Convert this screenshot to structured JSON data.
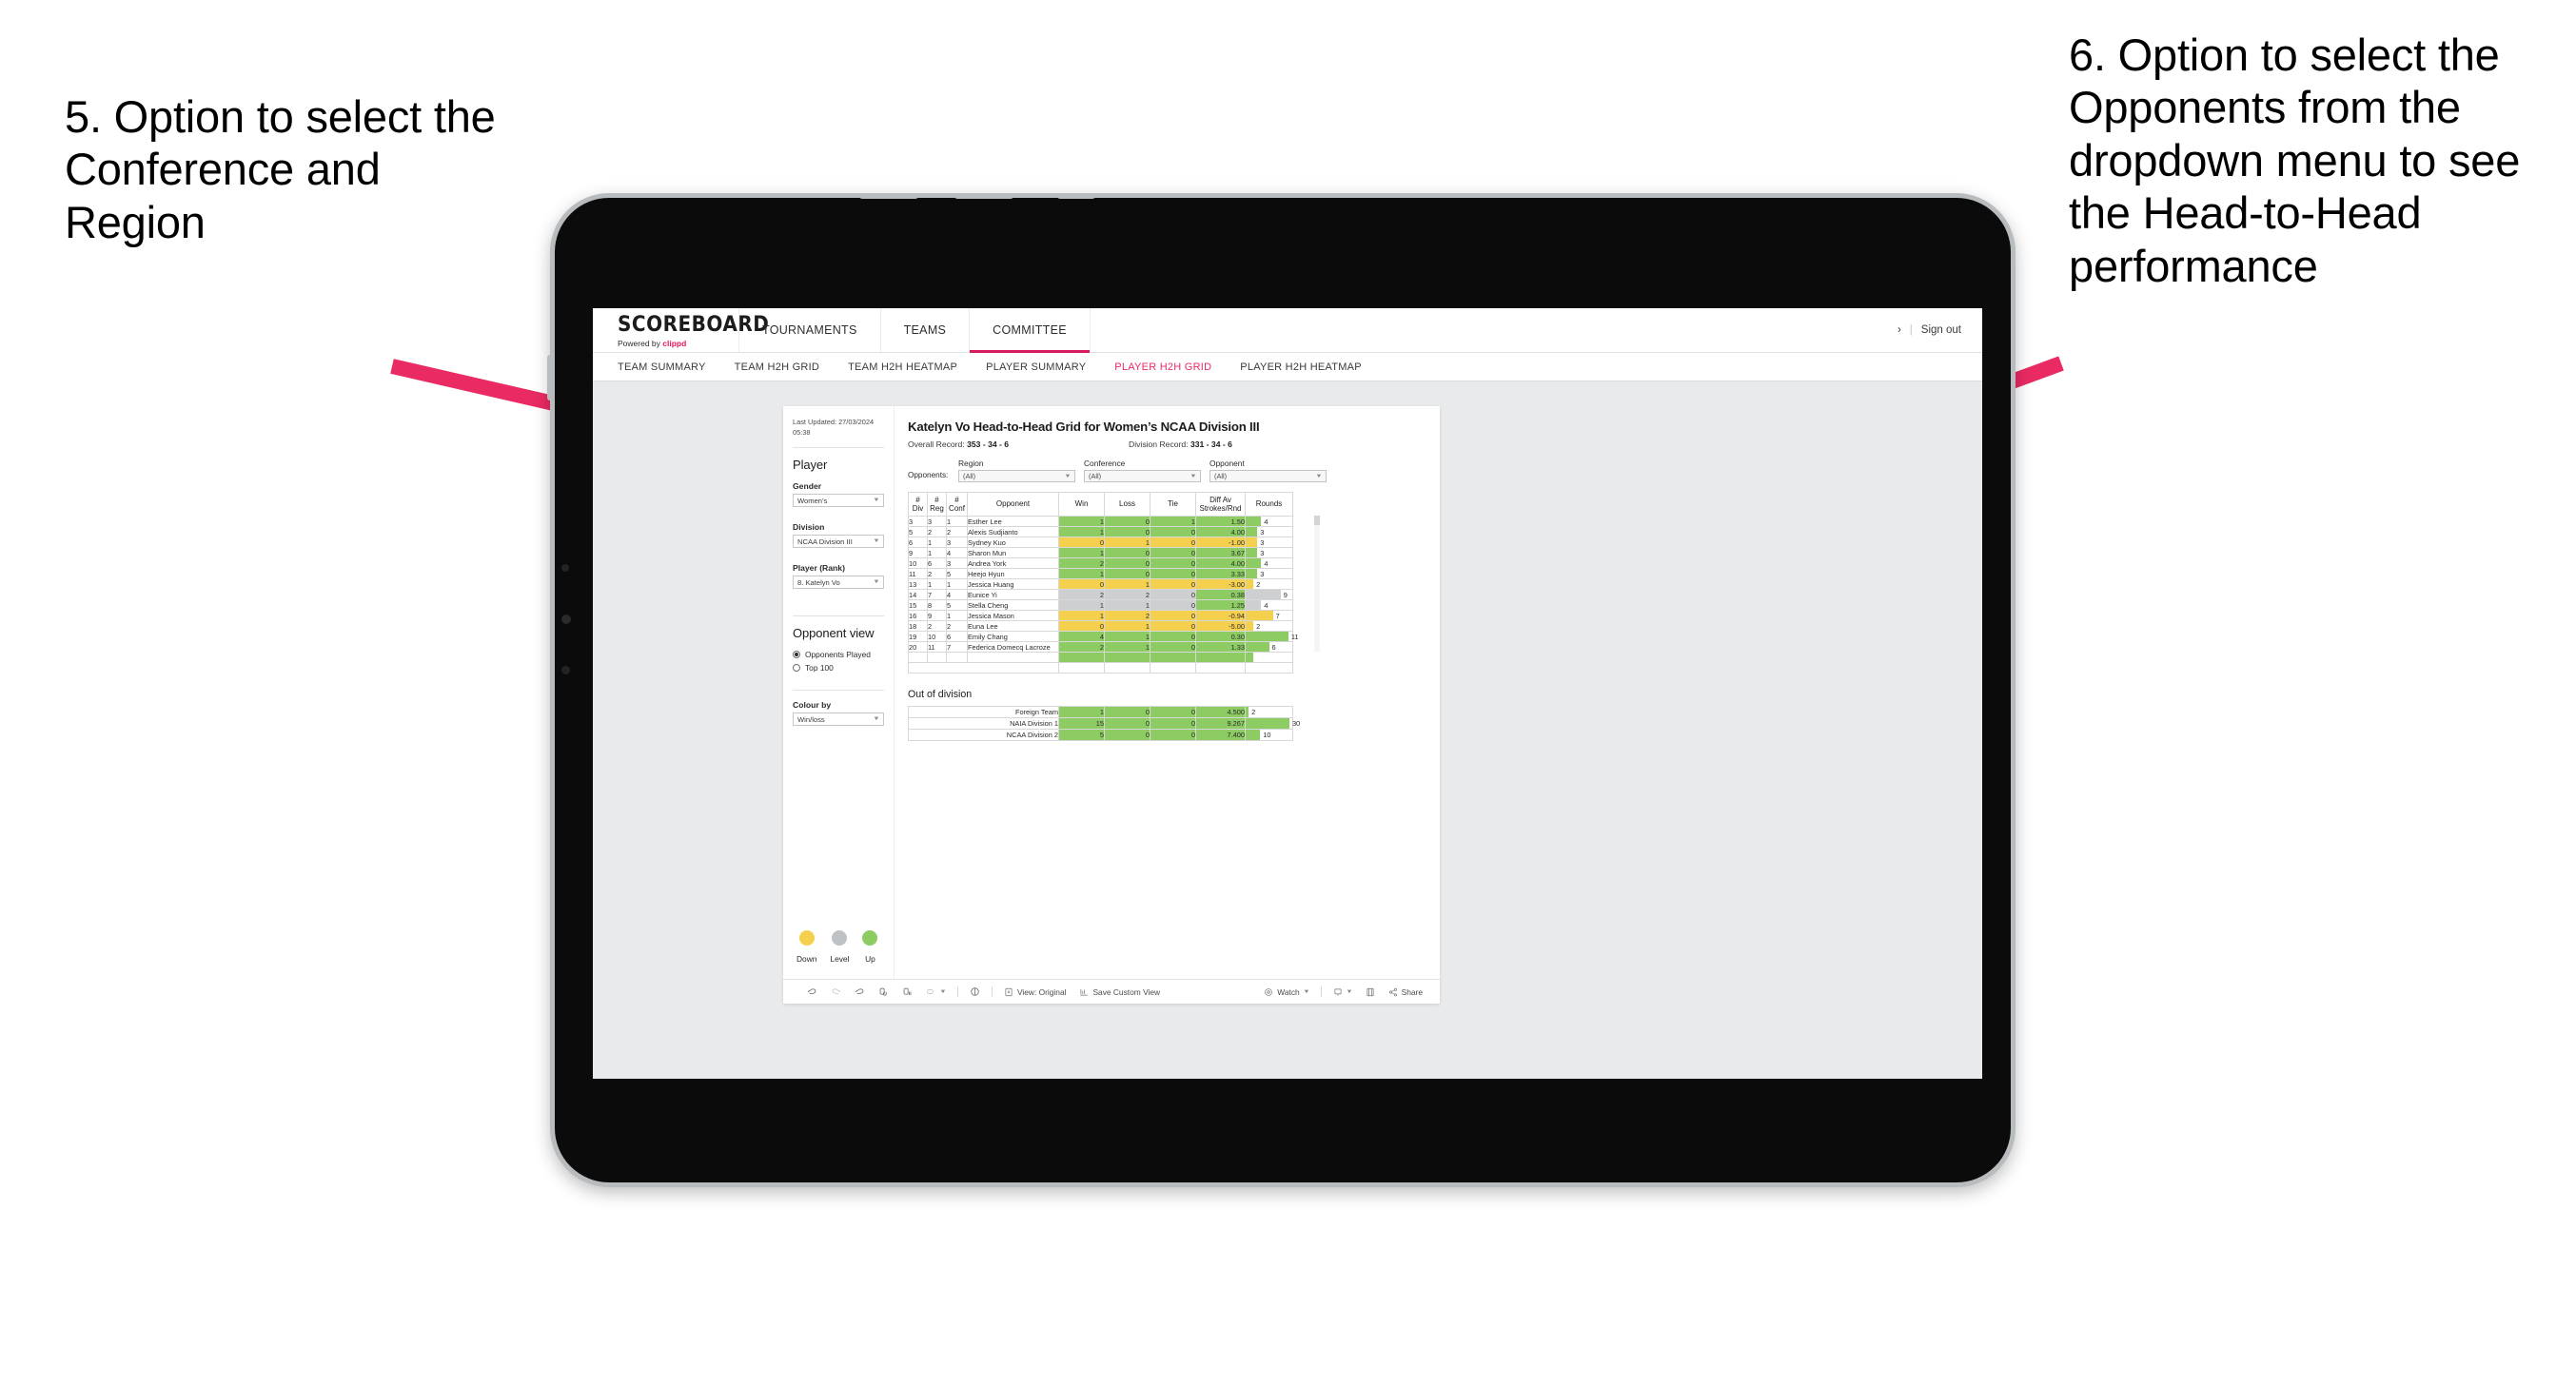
{
  "annotations": {
    "left": "5. Option to select the Conference and Region",
    "right": "6. Option to select the Opponents from the dropdown menu to see the Head-to-Head performance"
  },
  "app": {
    "brand_line1": "SCOREBOARD",
    "brand_line2_prefix": "Powered by ",
    "brand_line2_name": "clippd",
    "nav_tabs": [
      {
        "label": "TOURNAMENTS",
        "active": false
      },
      {
        "label": "TEAMS",
        "active": false
      },
      {
        "label": "COMMITTEE",
        "active": true
      }
    ],
    "account_chevron": "›",
    "separator": "|",
    "sign_out": "Sign out",
    "sub_tabs": [
      {
        "label": "TEAM SUMMARY",
        "active": false
      },
      {
        "label": "TEAM H2H GRID",
        "active": false
      },
      {
        "label": "TEAM H2H HEATMAP",
        "active": false
      },
      {
        "label": "PLAYER SUMMARY",
        "active": false
      },
      {
        "label": "PLAYER H2H GRID",
        "active": true
      },
      {
        "label": "PLAYER H2H HEATMAP",
        "active": false
      }
    ]
  },
  "sidebar": {
    "last_updated": "Last Updated: 27/03/2024 05:38",
    "player_heading": "Player",
    "gender_label": "Gender",
    "gender_value": "Women’s",
    "division_label": "Division",
    "division_value": "NCAA Division III",
    "player_rank_label": "Player (Rank)",
    "player_rank_value": "8. Katelyn Vo",
    "opponent_view_heading": "Opponent view",
    "opponent_view_options": [
      {
        "label": "Opponents Played",
        "selected": true
      },
      {
        "label": "Top 100",
        "selected": false
      }
    ],
    "colour_by_label": "Colour by",
    "colour_by_value": "Win/loss",
    "legend": [
      {
        "label": "Down",
        "color": "#f5d04e"
      },
      {
        "label": "Level",
        "color": "#bfc2c4"
      },
      {
        "label": "Up",
        "color": "#8ccc62"
      }
    ]
  },
  "viz": {
    "title": "Katelyn Vo Head-to-Head Grid for Women’s NCAA Division III",
    "overall_record_label": "Overall Record: ",
    "overall_record_value": "353 -  34 - 6",
    "division_record_label": "Division Record: ",
    "division_record_value": "331 -  34 - 6",
    "filters_prefix": "Opponents:",
    "filters": [
      {
        "name": "Region",
        "value": "(All)"
      },
      {
        "name": "Conference",
        "value": "(All)"
      },
      {
        "name": "Opponent",
        "value": "(All)"
      }
    ],
    "out_of_division_title": "Out of division"
  },
  "chart_data": {
    "type": "table",
    "title": "Katelyn Vo Head-to-Head Grid for Women’s NCAA Division III",
    "columns": [
      "# Div",
      "# Reg",
      "# Conf",
      "Opponent",
      "Win",
      "Loss",
      "Tie",
      "Diff Av Strokes/Rnd",
      "Rounds"
    ],
    "column_headers_multiline": [
      [
        "#",
        "Div"
      ],
      [
        "#",
        "Reg"
      ],
      [
        "#",
        "Conf"
      ],
      [
        "Opponent"
      ],
      [
        "Win"
      ],
      [
        "Loss"
      ],
      [
        "Tie"
      ],
      [
        "Diff Av",
        "Strokes/Rnd"
      ],
      [
        "Rounds"
      ]
    ],
    "rounds_max": 12,
    "rows": [
      {
        "div": "3",
        "reg": "3",
        "conf": "1",
        "opponent": "Esther Lee",
        "win": "1",
        "loss": "0",
        "tie": "1",
        "diff": "1.50",
        "rounds": "4",
        "color": "#8ccc62"
      },
      {
        "div": "5",
        "reg": "2",
        "conf": "2",
        "opponent": "Alexis Sudjianto",
        "win": "1",
        "loss": "0",
        "tie": "0",
        "diff": "4.00",
        "rounds": "3",
        "color": "#8ccc62"
      },
      {
        "div": "6",
        "reg": "1",
        "conf": "3",
        "opponent": "Sydney Kuo",
        "win": "0",
        "loss": "1",
        "tie": "0",
        "diff": "-1.00",
        "rounds": "3",
        "color": "#f5d04e"
      },
      {
        "div": "9",
        "reg": "1",
        "conf": "4",
        "opponent": "Sharon Mun",
        "win": "1",
        "loss": "0",
        "tie": "0",
        "diff": "3.67",
        "rounds": "3",
        "color": "#8ccc62"
      },
      {
        "div": "10",
        "reg": "6",
        "conf": "3",
        "opponent": "Andrea York",
        "win": "2",
        "loss": "0",
        "tie": "0",
        "diff": "4.00",
        "rounds": "4",
        "color": "#8ccc62"
      },
      {
        "div": "11",
        "reg": "2",
        "conf": "5",
        "opponent": "Heejo Hyun",
        "win": "1",
        "loss": "0",
        "tie": "0",
        "diff": "3.33",
        "rounds": "3",
        "color": "#8ccc62"
      },
      {
        "div": "13",
        "reg": "1",
        "conf": "1",
        "opponent": "Jessica Huang",
        "win": "0",
        "loss": "1",
        "tie": "0",
        "diff": "-3.00",
        "rounds": "2",
        "color": "#f5d04e"
      },
      {
        "div": "14",
        "reg": "7",
        "conf": "4",
        "opponent": "Eunice Yi",
        "win": "2",
        "loss": "2",
        "tie": "0",
        "diff": "0.38",
        "rounds": "9",
        "color": "#cdcfd1",
        "diff_color": "#8ccc62"
      },
      {
        "div": "15",
        "reg": "8",
        "conf": "5",
        "opponent": "Stella Cheng",
        "win": "1",
        "loss": "1",
        "tie": "0",
        "diff": "1.25",
        "rounds": "4",
        "color": "#cdcfd1",
        "diff_color": "#8ccc62"
      },
      {
        "div": "16",
        "reg": "9",
        "conf": "1",
        "opponent": "Jessica Mason",
        "win": "1",
        "loss": "2",
        "tie": "0",
        "diff": "-0.94",
        "rounds": "7",
        "color": "#f5d04e"
      },
      {
        "div": "18",
        "reg": "2",
        "conf": "2",
        "opponent": "Euna Lee",
        "win": "0",
        "loss": "1",
        "tie": "0",
        "diff": "-5.00",
        "rounds": "2",
        "color": "#f5d04e"
      },
      {
        "div": "19",
        "reg": "10",
        "conf": "6",
        "opponent": "Emily Chang",
        "win": "4",
        "loss": "1",
        "tie": "0",
        "diff": "0.30",
        "rounds": "11",
        "color": "#8ccc62"
      },
      {
        "div": "20",
        "reg": "11",
        "conf": "7",
        "opponent": "Federica Domecq Lacroze",
        "win": "2",
        "loss": "1",
        "tie": "0",
        "diff": "1.33",
        "rounds": "6",
        "color": "#8ccc62"
      }
    ],
    "out_of_division": {
      "rounds_max": 32,
      "rows": [
        {
          "name": "Foreign Team",
          "win": "1",
          "loss": "0",
          "tie": "0",
          "diff": "4.500",
          "rounds": "2",
          "color": "#8ccc62"
        },
        {
          "name": "NAIA Division 1",
          "win": "15",
          "loss": "0",
          "tie": "0",
          "diff": "9.267",
          "rounds": "30",
          "color": "#8ccc62"
        },
        {
          "name": "NCAA Division 2",
          "win": "5",
          "loss": "0",
          "tie": "0",
          "diff": "7.400",
          "rounds": "10",
          "color": "#8ccc62"
        }
      ]
    }
  },
  "toolbar": {
    "view_label": "View: Original",
    "save_label": "Save Custom View",
    "watch_label": "Watch",
    "share_label": "Share"
  }
}
